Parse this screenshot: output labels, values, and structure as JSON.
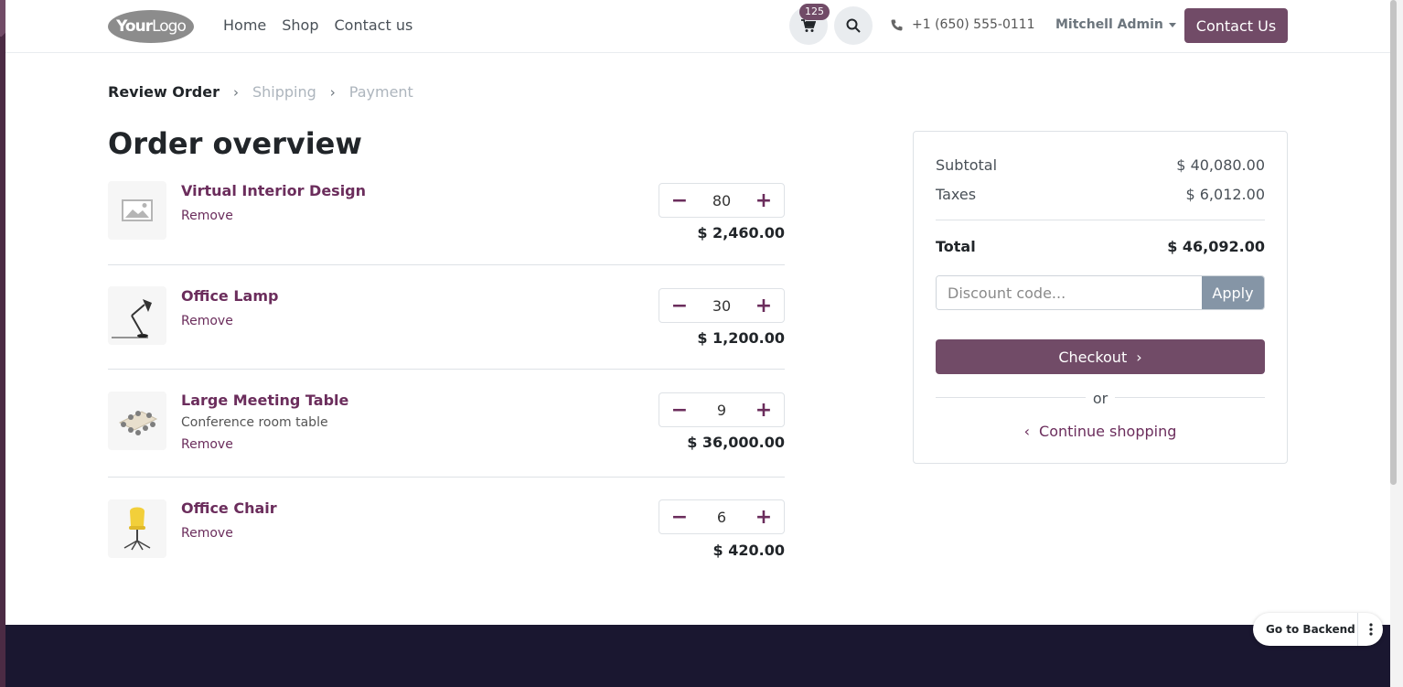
{
  "header": {
    "logo_bold": "Your",
    "logo_light": "Logo",
    "nav": [
      "Home",
      "Shop",
      "Contact us"
    ],
    "cart_count": "125",
    "phone": "+1 (650) 555-0111",
    "user": "Mitchell Admin",
    "contact_button": "Contact Us"
  },
  "steps": [
    "Review Order",
    "Shipping",
    "Payment"
  ],
  "title": "Order overview",
  "items": [
    {
      "name": "Virtual Interior Design",
      "desc": "",
      "remove": "Remove",
      "qty": "80",
      "price": "$ 2,460.00"
    },
    {
      "name": "Office Lamp",
      "desc": "",
      "remove": "Remove",
      "qty": "30",
      "price": "$ 1,200.00"
    },
    {
      "name": "Large Meeting Table",
      "desc": "Conference room table",
      "remove": "Remove",
      "qty": "9",
      "price": "$ 36,000.00"
    },
    {
      "name": "Office Chair",
      "desc": "",
      "remove": "Remove",
      "qty": "6",
      "price": "$ 420.00"
    }
  ],
  "summary": {
    "subtotal_label": "Subtotal",
    "subtotal": "$ 40,080.00",
    "taxes_label": "Taxes",
    "taxes": "$ 6,012.00",
    "total_label": "Total",
    "total": "$ 46,092.00",
    "discount_placeholder": "Discount code...",
    "apply": "Apply",
    "checkout": "Checkout",
    "or": "or",
    "continue": "Continue shopping"
  },
  "backend_button": "Go to Backend",
  "colors": {
    "brand": "#714b67",
    "footer": "#1a1730"
  }
}
